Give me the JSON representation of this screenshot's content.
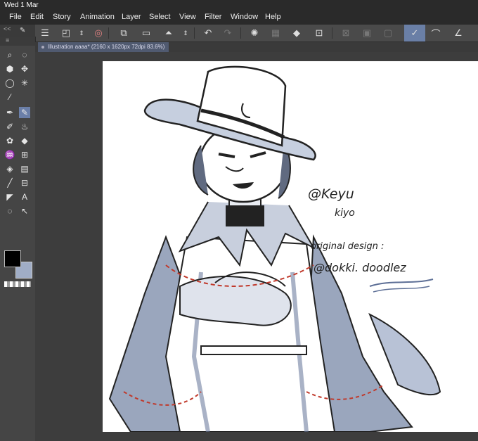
{
  "status": {
    "datetime": "Wed 1 Mar"
  },
  "menu": [
    "File",
    "Edit",
    "Story",
    "Animation",
    "Layer",
    "Select",
    "View",
    "Filter",
    "Window",
    "Help"
  ],
  "toolbar": {
    "icons": [
      "menu-icon",
      "new-layer-icon",
      "stepper-icon",
      "spiral-icon",
      "copy-icon",
      "folder-icon",
      "fill-icon",
      "stepper-icon",
      "undo-icon",
      "redo-icon",
      "sparkle-icon",
      "grid-icon",
      "bucket-icon",
      "transform-icon",
      "ruler-off-icon",
      "ruler-box-icon",
      "frame-icon",
      "pen-check-icon",
      "brush-icon",
      "pen-flat-icon"
    ]
  },
  "panel": {
    "collapse_label": "<<"
  },
  "document": {
    "tab_label": "Illustration aaaa* (2160 x 1620px 72dpi 83.6%)"
  },
  "colors": {
    "main": "#000000",
    "sub": "#a0adc6",
    "accent": "#6a7fa6"
  },
  "canvas_text": {
    "handle": "@Keyu",
    "name": "kiyo",
    "credit_label": "original design :",
    "credit_handle": "@dokki. doodlez"
  }
}
